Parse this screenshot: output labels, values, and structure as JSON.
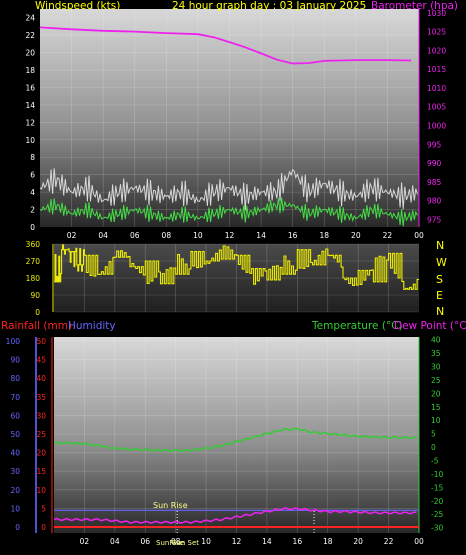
{
  "header": {
    "windspeed_label": "Windspeed (kts)",
    "title": "24 hour graph day : 03 January 2025",
    "barometer_label": "Barometer (hpa)"
  },
  "lower_header": {
    "rainfall_label": "Rainfall (mm)",
    "humidity_label": "Humidity",
    "temperature_label": "Temperature (°C)",
    "dewpoint_label": "Dew Point (°C)"
  },
  "colors": {
    "wind_gust": "#d8d8d8",
    "wind_avg": "#44dd44",
    "barometer": "#ee22ee",
    "direction": "#eeee00",
    "temperature": "#33cc33",
    "dewpoint": "#ee22ee",
    "humidity": "#6666ff",
    "rainfall": "#ff2222",
    "header_yellow": "#ffff00",
    "sunrise_text": "#ffff88"
  },
  "compass_letters": [
    "N",
    "W",
    "S",
    "E",
    "N"
  ],
  "sun": {
    "sunrise_label": "Sun Rise",
    "bottom_labels": [
      "SunRise",
      "Sun Set"
    ]
  },
  "chart_data": [
    {
      "type": "line",
      "name": "wind-barometer",
      "x_ticks": [
        "02",
        "04",
        "06",
        "08",
        "10",
        "12",
        "14",
        "16",
        "18",
        "20",
        "22",
        "00"
      ],
      "left_axis": {
        "label": "Windspeed (kts)",
        "ticks": [
          0,
          2,
          4,
          6,
          8,
          10,
          12,
          14,
          16,
          18,
          20,
          22,
          24
        ],
        "range": [
          0,
          25
        ]
      },
      "right_axis": {
        "label": "Barometer (hpa)",
        "ticks": [
          975,
          980,
          985,
          990,
          995,
          1000,
          1005,
          1010,
          1015,
          1020,
          1025,
          1030
        ],
        "range": [
          973,
          1031
        ]
      },
      "series": [
        {
          "axis": "right",
          "hours": [
            0,
            2,
            4,
            6,
            8,
            10,
            11,
            12,
            13,
            14,
            15,
            16,
            17,
            18,
            20,
            22,
            23.5
          ],
          "values": [
            1026.1,
            1025.6,
            1025.2,
            1025.0,
            1024.6,
            1024.3,
            1023.5,
            1022.2,
            1020.8,
            1019.2,
            1017.5,
            1016.5,
            1016.6,
            1017.2,
            1017.4,
            1017.4,
            1017.3
          ]
        },
        {
          "axis": "left",
          "hours": [
            0,
            1,
            2,
            3,
            4,
            5,
            6,
            7,
            8,
            9,
            10,
            11,
            12,
            13,
            14,
            15,
            16,
            17,
            18,
            19,
            20,
            21,
            22,
            23,
            24
          ],
          "values": [
            4.5,
            5.5,
            4,
            4.5,
            3,
            4,
            4.5,
            4,
            3.5,
            4,
            3,
            4,
            4.5,
            3.5,
            4,
            4,
            6.5,
            4,
            5,
            4,
            3.5,
            4.5,
            4,
            3.5,
            4
          ]
        },
        {
          "axis": "left",
          "hours": [
            0,
            1,
            2,
            3,
            4,
            5,
            6,
            7,
            8,
            9,
            10,
            11,
            12,
            13,
            14,
            15,
            16,
            17,
            18,
            19,
            20,
            21,
            22,
            23,
            24
          ],
          "values": [
            2,
            2.5,
            1.5,
            2,
            1,
            1.5,
            2,
            1.5,
            1,
            1.5,
            1,
            1.5,
            2,
            1.5,
            2,
            2.5,
            2.5,
            1.5,
            2,
            1.5,
            1,
            2,
            1.5,
            1,
            1.5
          ]
        }
      ]
    },
    {
      "type": "line",
      "name": "wind-direction",
      "x_ticks": [
        "02",
        "04",
        "06",
        "08",
        "10",
        "12",
        "14",
        "16",
        "18",
        "20",
        "22",
        "00"
      ],
      "y_ticks": [
        0,
        90,
        180,
        270,
        360
      ],
      "range": [
        0,
        360
      ],
      "series": [
        {
          "hours": [
            0,
            0.5,
            1,
            1.5,
            2,
            3,
            4,
            5,
            6,
            7,
            8,
            9,
            10,
            11,
            12,
            13,
            14,
            15,
            16,
            17,
            18,
            19,
            20,
            21,
            22,
            23,
            24
          ],
          "values": [
            160,
            330,
            320,
            250,
            300,
            200,
            290,
            240,
            270,
            150,
            200,
            320,
            270,
            280,
            300,
            230,
            170,
            200,
            330,
            250,
            300,
            180,
            220,
            160,
            310,
            120,
            250
          ]
        }
      ]
    },
    {
      "type": "line",
      "name": "temp-humidity-rain",
      "x_ticks": [
        "02",
        "04",
        "06",
        "08",
        "10",
        "12",
        "14",
        "16",
        "18",
        "20",
        "22",
        "00"
      ],
      "left_axis_humidity": {
        "label": "Humidity",
        "ticks": [
          0,
          10,
          20,
          30,
          40,
          50,
          60,
          70,
          80,
          90,
          100
        ],
        "range": [
          0,
          100
        ]
      },
      "left_axis_rain": {
        "label": "Rainfall (mm)",
        "ticks": [
          0,
          5,
          10,
          15,
          20,
          25,
          30,
          35,
          40,
          45,
          50
        ],
        "range": [
          0,
          50
        ]
      },
      "right_axis": {
        "label": "Temperature (°C)",
        "ticks": [
          -30,
          -25,
          -20,
          -15,
          -10,
          -5,
          0,
          5,
          10,
          15,
          20,
          25,
          30,
          35,
          40
        ],
        "range": [
          -32,
          41
        ]
      },
      "series": [
        {
          "name": "Temperature (°C)",
          "axis": "right",
          "hours": [
            0,
            1,
            2,
            3,
            4,
            5,
            6,
            7,
            8,
            9,
            10,
            11,
            12,
            13,
            14,
            15,
            16,
            17,
            18,
            19,
            20,
            21,
            22,
            23,
            24
          ],
          "values": [
            1.5,
            1.5,
            1.2,
            0.5,
            -0.5,
            -0.8,
            -1,
            -1.2,
            -1.3,
            -1.2,
            -0.5,
            0.5,
            2,
            3.5,
            5,
            6.5,
            6.8,
            5.5,
            5,
            4.5,
            4,
            3.8,
            3.6,
            3.5,
            3.5
          ]
        },
        {
          "name": "Dew Point (°C)",
          "axis": "right",
          "hours": [
            0,
            1,
            2,
            3,
            4,
            5,
            6,
            7,
            8,
            9,
            10,
            11,
            12,
            13,
            14,
            15,
            16,
            17,
            18,
            19,
            20,
            21,
            22,
            23,
            24
          ],
          "values": [
            -27,
            -27,
            -27,
            -27,
            -27.5,
            -28,
            -28,
            -28,
            -28,
            -28,
            -27.5,
            -27,
            -26,
            -25,
            -24,
            -23,
            -23,
            -23.5,
            -24,
            -24,
            -24.2,
            -24.5,
            -24.5,
            -24.5,
            -24.5
          ]
        },
        {
          "name": "Humidity",
          "axis": "humidity",
          "hours": [
            0,
            24
          ],
          "values": [
            9,
            9
          ]
        },
        {
          "name": "Rainfall (mm)",
          "axis": "rain",
          "hours": [
            0,
            24
          ],
          "values": [
            0,
            0
          ]
        }
      ]
    }
  ]
}
